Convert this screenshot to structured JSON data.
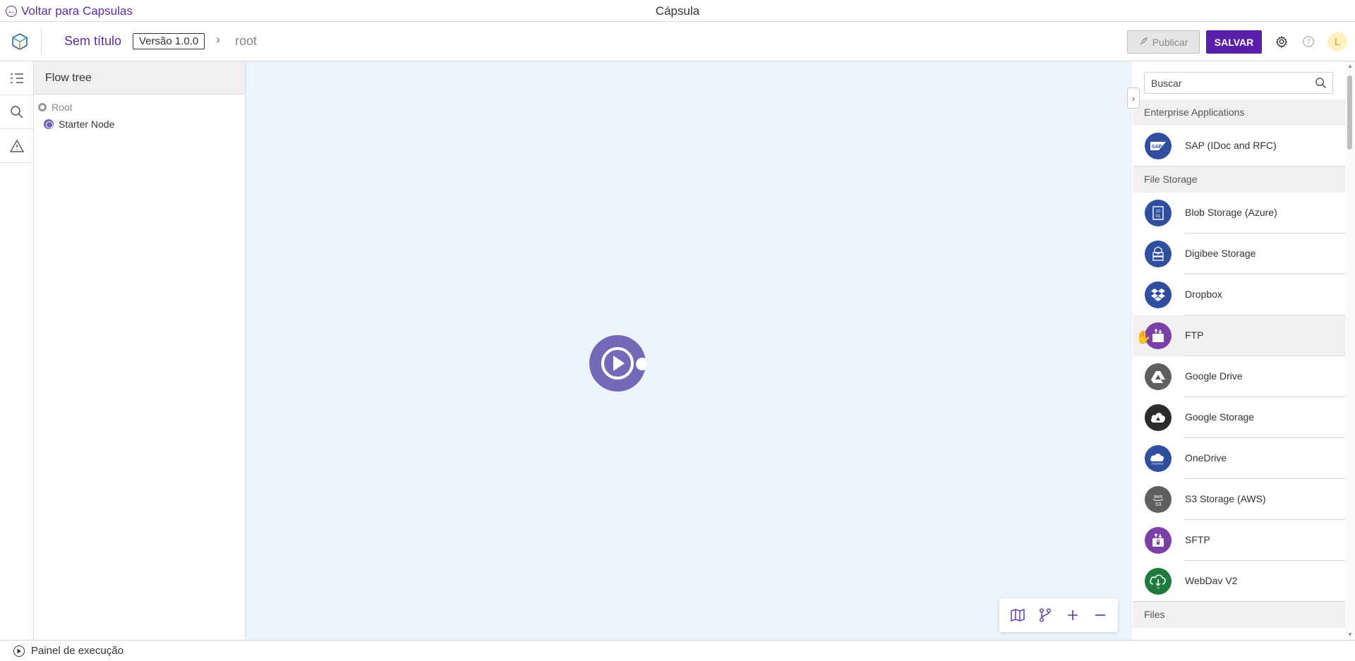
{
  "topbar": {
    "back_label": "Voltar para Capsulas",
    "title": "Cápsula"
  },
  "header": {
    "capsule_name": "Sem título",
    "version": "Versão 1.0.0",
    "breadcrumb_current": "root",
    "publish_label": "Publicar",
    "save_label": "SALVAR",
    "avatar_initial": "L"
  },
  "colors": {
    "brand_purple": "#5a1fa8",
    "node_purple": "#7469b6",
    "canvas_bg": "#edf3fb"
  },
  "rail": {
    "icons": [
      "tree-list-icon",
      "search-icon",
      "warning-icon"
    ]
  },
  "flow_tree": {
    "title": "Flow tree",
    "items": [
      {
        "label": "Root"
      },
      {
        "label": "Starter Node"
      }
    ]
  },
  "canvas": {
    "tools": [
      "map-icon",
      "branch-icon",
      "zoom-in-icon",
      "zoom-out-icon"
    ]
  },
  "components": {
    "search_placeholder": "Buscar",
    "categories": [
      {
        "name": "Enterprise Applications",
        "items": [
          {
            "label": "SAP (IDoc and RFC)",
            "icon": "sap-icon",
            "color": "#2f4f9e"
          }
        ]
      },
      {
        "name": "File Storage",
        "items": [
          {
            "label": "Blob Storage (Azure)",
            "icon": "blob-storage-icon",
            "color": "#2f4f9e"
          },
          {
            "label": "Digibee Storage",
            "icon": "digibee-storage-icon",
            "color": "#2f4f9e"
          },
          {
            "label": "Dropbox",
            "icon": "dropbox-icon",
            "color": "#2f4f9e"
          },
          {
            "label": "FTP",
            "icon": "ftp-icon",
            "color": "#7b3fa8"
          },
          {
            "label": "Google Drive",
            "icon": "google-drive-icon",
            "color": "#5f5f5f"
          },
          {
            "label": "Google Storage",
            "icon": "google-storage-icon",
            "color": "#2b2b2b"
          },
          {
            "label": "OneDrive",
            "icon": "onedrive-icon",
            "color": "#2f4f9e"
          },
          {
            "label": "S3 Storage (AWS)",
            "icon": "aws-s3-icon",
            "color": "#5f5f5f"
          },
          {
            "label": "SFTP",
            "icon": "sftp-icon",
            "color": "#7b3fa8"
          },
          {
            "label": "WebDav V2",
            "icon": "webdav-icon",
            "color": "#1f7a3e"
          }
        ]
      },
      {
        "name": "Files",
        "items": []
      }
    ]
  },
  "bottombar": {
    "label": "Painel de execução"
  }
}
